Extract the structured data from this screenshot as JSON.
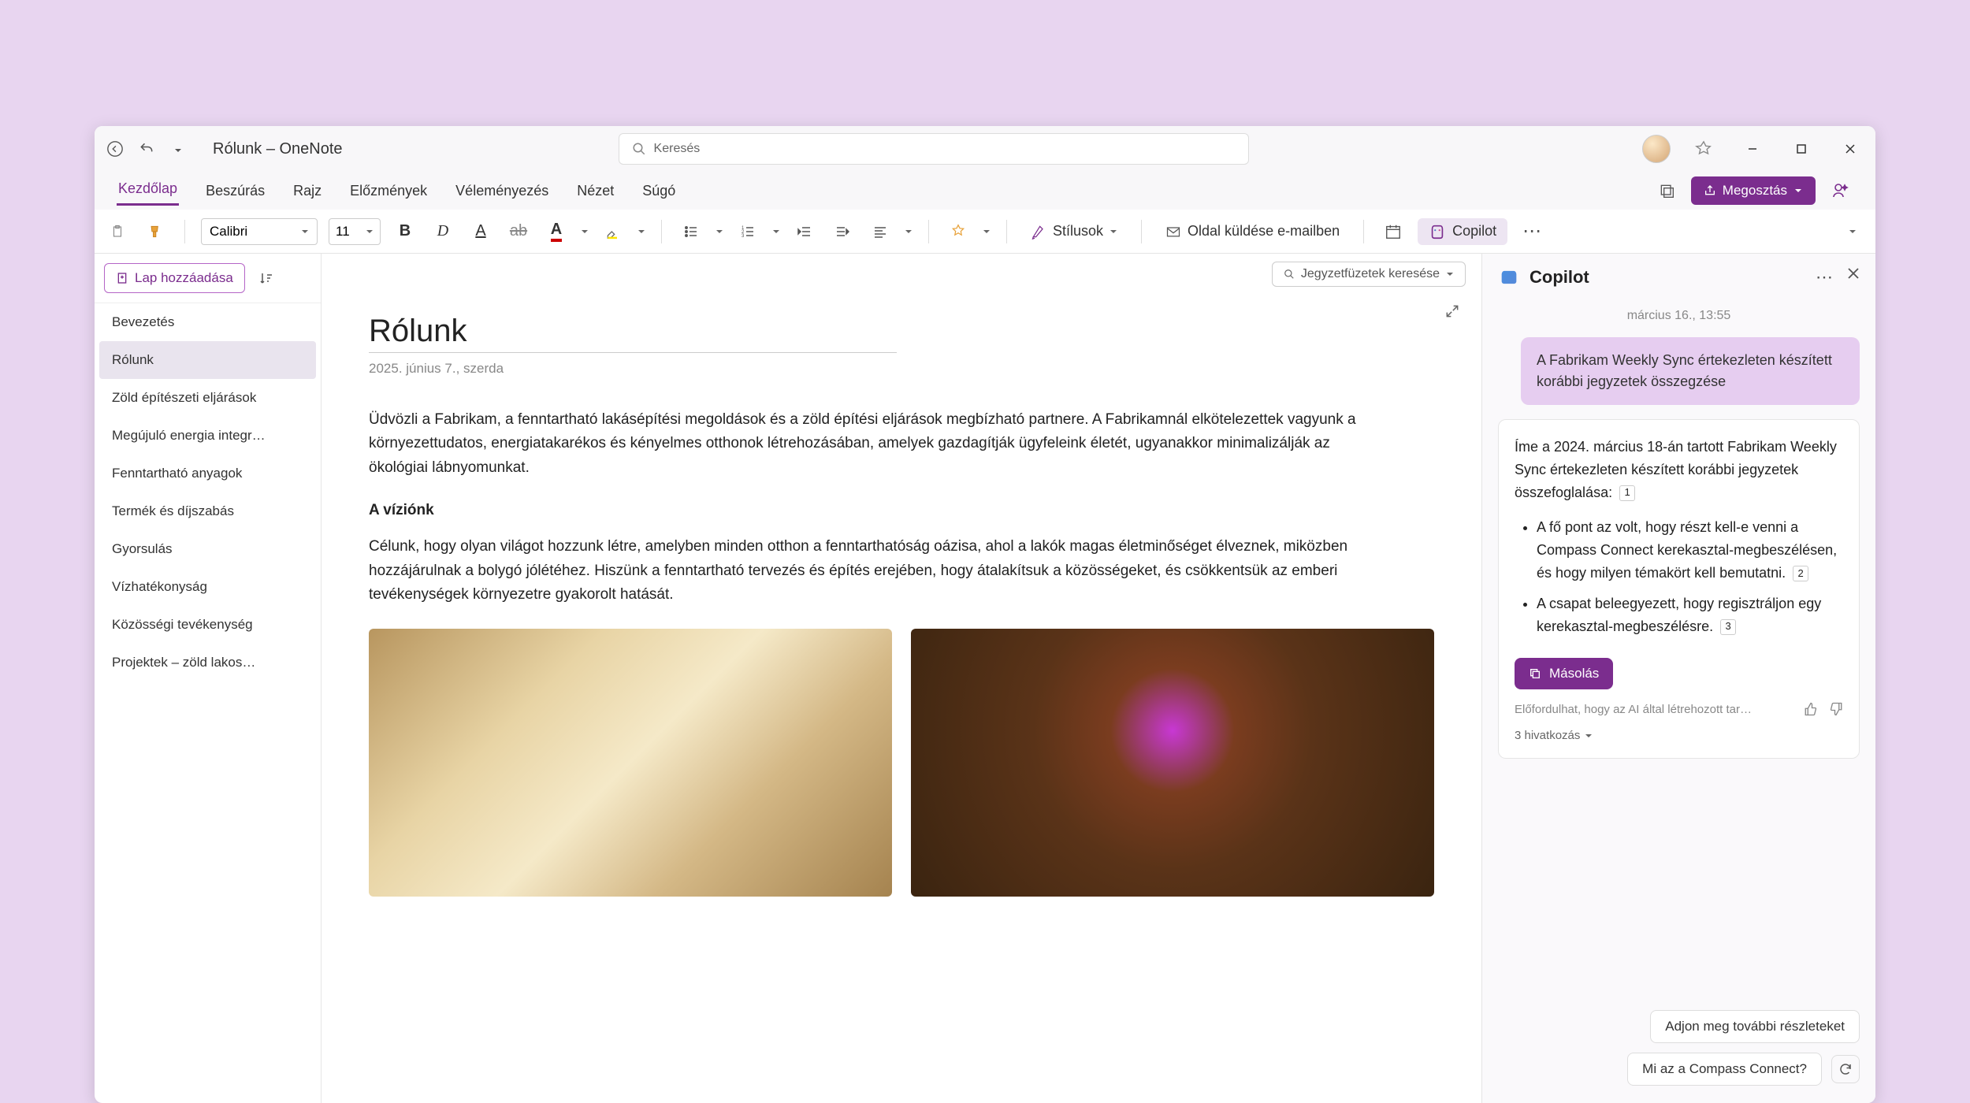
{
  "app": {
    "title": "Rólunk – OneNote"
  },
  "search": {
    "placeholder": "Keresés"
  },
  "ribbon": {
    "tabs": [
      "Kezdőlap",
      "Beszúrás",
      "Rajz",
      "Előzmények",
      "Véleményezés",
      "Nézet",
      "Súgó"
    ],
    "active_index": 0,
    "share_label": "Megosztás"
  },
  "toolbar": {
    "font_name": "Calibri",
    "font_size": "11",
    "styles_label": "Stílusok",
    "email_page_label": "Oldal küldése e-mailben",
    "copilot_label": "Copilot"
  },
  "notebook_search": {
    "label": "Jegyzetfüzetek keresése"
  },
  "sidebar": {
    "add_page_label": "Lap hozzáadása",
    "items": [
      "Bevezetés",
      "Rólunk",
      "Zöld építészeti eljárások",
      "Megújuló energia integr…",
      "Fenntartható anyagok",
      "Termék és díjszabás",
      "Gyorsulás",
      "Vízhatékonyság",
      "Közösségi tevékenység",
      "Projektek – zöld lakos…"
    ],
    "selected_index": 1
  },
  "page": {
    "title": "Rólunk",
    "date": "2025. június 7., szerda",
    "intro": "Üdvözli a Fabrikam, a fenntartható lakásépítési megoldások és a zöld építési eljárások megbízható partnere. A Fabrikamnál elkötelezettek vagyunk a környezettudatos, energiatakarékos és kényelmes otthonok létrehozásában, amelyek gazdagítják ügyfeleink életét, ugyanakkor minimalizálják az ökológiai lábnyomunkat.",
    "vision_heading": "A víziónk",
    "vision_body": "Célunk, hogy olyan világot hozzunk létre, amelyben minden otthon a fenntarthatóság oázisa, ahol a lakók magas életminőséget élveznek, miközben hozzájárulnak a bolygó jólétéhez. Hiszünk a fenntartható tervezés és építés erejében, hogy átalakítsuk a közösségeket, és csökkentsük az emberi tevékenységek környezetre gyakorolt hatását."
  },
  "copilot": {
    "title": "Copilot",
    "timestamp": "március 16., 13:55",
    "user_message": "A Fabrikam Weekly Sync értekezleten készített korábbi jegyzetek összegzése",
    "assistant_intro": "Íme a 2024. március 18-án tartott Fabrikam Weekly Sync értekezleten készített korábbi jegyzetek összefoglalása:",
    "bullets": [
      "A fő pont az volt, hogy részt kell-e venni a Compass Connect kerekasztal-megbeszélésen, és hogy milyen témakört kell bemutatni.",
      "A csapat beleegyezett, hogy regisztráljon egy kerekasztal-megbeszélésre."
    ],
    "bullet_refs": [
      "2",
      "3"
    ],
    "intro_ref": "1",
    "copy_label": "Másolás",
    "disclaimer": "Előfordulhat, hogy az AI által létrehozott tar…",
    "references_label": "3 hivatkozás",
    "suggestions": [
      "Adjon meg további részleteket",
      "Mi az a Compass Connect?"
    ]
  },
  "colors": {
    "accent": "#7b2d8e",
    "accent_light": "#e6cdf0"
  }
}
